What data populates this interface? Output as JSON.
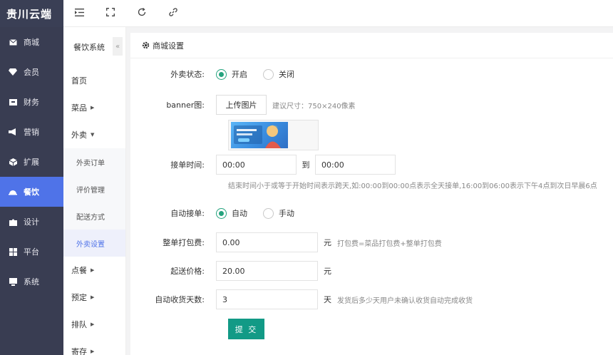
{
  "brand": "贵川云端",
  "nav": [
    {
      "label": "商城",
      "icon": "mail-icon"
    },
    {
      "label": "会员",
      "icon": "gem-icon"
    },
    {
      "label": "财务",
      "icon": "wallet-icon"
    },
    {
      "label": "营销",
      "icon": "megaphone-icon"
    },
    {
      "label": "扩展",
      "icon": "cube-icon"
    },
    {
      "label": "餐饮",
      "icon": "cloche-icon",
      "active": true
    },
    {
      "label": "设计",
      "icon": "puzzle-icon"
    },
    {
      "label": "平台",
      "icon": "grid-icon"
    },
    {
      "label": "系统",
      "icon": "monitor-icon"
    }
  ],
  "submenu": {
    "title": "餐饮系统",
    "collapse_glyph": "«",
    "home": "首页",
    "dishes": "菜品",
    "takeout": "外卖",
    "takeout_children": [
      "外卖订单",
      "评价管理",
      "配送方式",
      "外卖设置"
    ],
    "order": "点餐",
    "reserve": "预定",
    "queue": "排队",
    "storage": "寄存"
  },
  "panel": {
    "title": "商城设置",
    "status_label": "外卖状态:",
    "status_on": "开启",
    "status_off": "关闭",
    "banner_label": "banner图:",
    "upload_label": "上传图片",
    "banner_hint": "建议尺寸：750×240像素",
    "time_label": "接单时间:",
    "time_start": "00:00",
    "time_sep": "到",
    "time_end": "00:00",
    "time_hint": "结束时间小于或等于开始时间表示跨天,如:00:00到00:00点表示全天接单,16:00到06:00表示下午4点到次日早晨6点",
    "auto_label": "自动接单:",
    "auto_on": "自动",
    "auto_off": "手动",
    "pack_label": "整单打包费:",
    "pack_value": "0.00",
    "pack_unit": "元",
    "pack_hint": "打包费=菜品打包费+整单打包费",
    "min_label": "起送价格:",
    "min_value": "20.00",
    "min_unit": "元",
    "days_label": "自动收货天数:",
    "days_value": "3",
    "days_unit": "天",
    "days_hint": "发货后多少天用户未确认收货自动完成收货",
    "submit": "提 交"
  },
  "colors": {
    "sidebar": "#393d52",
    "active_nav": "#4f73e8",
    "accent_green": "#25a37e",
    "submit": "#129a86"
  }
}
